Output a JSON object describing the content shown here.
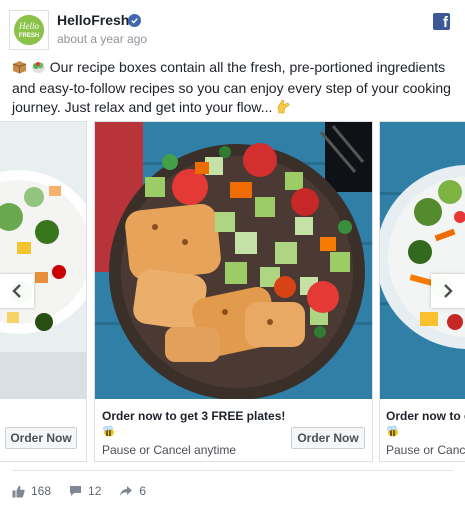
{
  "post": {
    "page_name": "HelloFresh",
    "timestamp": "about a year ago",
    "avatar_text": "Hello FRESH",
    "text": "Our recipe boxes contain all the fresh, pre-portioned ingredients and easy-to-follow recipes so you can enjoy every step of your cooking journey. Just relax and get into your flow..."
  },
  "carousel": {
    "cards": [
      {
        "title": "",
        "subtitle": "",
        "cta": "Order Now"
      },
      {
        "title": "Order now to get 3 FREE plates!",
        "subtitle": "Pause or Cancel anytime",
        "cta": "Order Now"
      },
      {
        "title": "Order now to g",
        "subtitle": "Pause or Cance",
        "cta": ""
      }
    ]
  },
  "engagement": {
    "likes": "168",
    "comments": "12",
    "shares": "6"
  },
  "colors": {
    "brand_green": "#8bc34a",
    "facebook_blue": "#3b5998",
    "verified_blue": "#4267b2"
  }
}
